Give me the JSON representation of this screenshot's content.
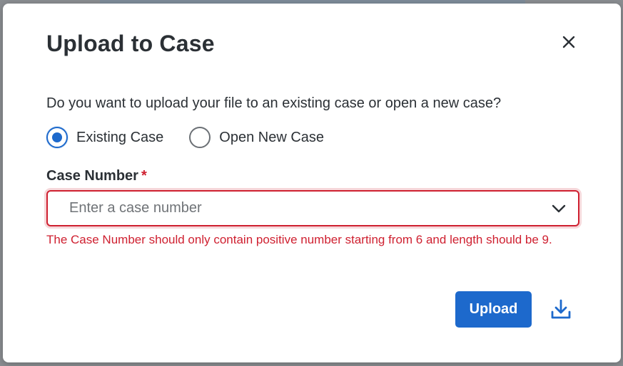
{
  "dialog": {
    "title": "Upload to Case",
    "close_icon": "close-icon",
    "question": "Do you want to upload your file to an existing case or open a new case?",
    "options": [
      {
        "label": "Existing Case",
        "selected": true
      },
      {
        "label": "Open New Case",
        "selected": false
      }
    ],
    "case_number": {
      "label": "Case Number",
      "required_mark": "*",
      "placeholder": "Enter a case number",
      "dropdown_icon": "chevron-down-icon",
      "error": "The Case Number should only contain positive number starting from 6 and length should be 9."
    },
    "upload_label": "Upload",
    "download_icon": "download-icon"
  },
  "colors": {
    "primary": "#1d69cc",
    "error": "#cf2030",
    "text": "#2b3035"
  }
}
